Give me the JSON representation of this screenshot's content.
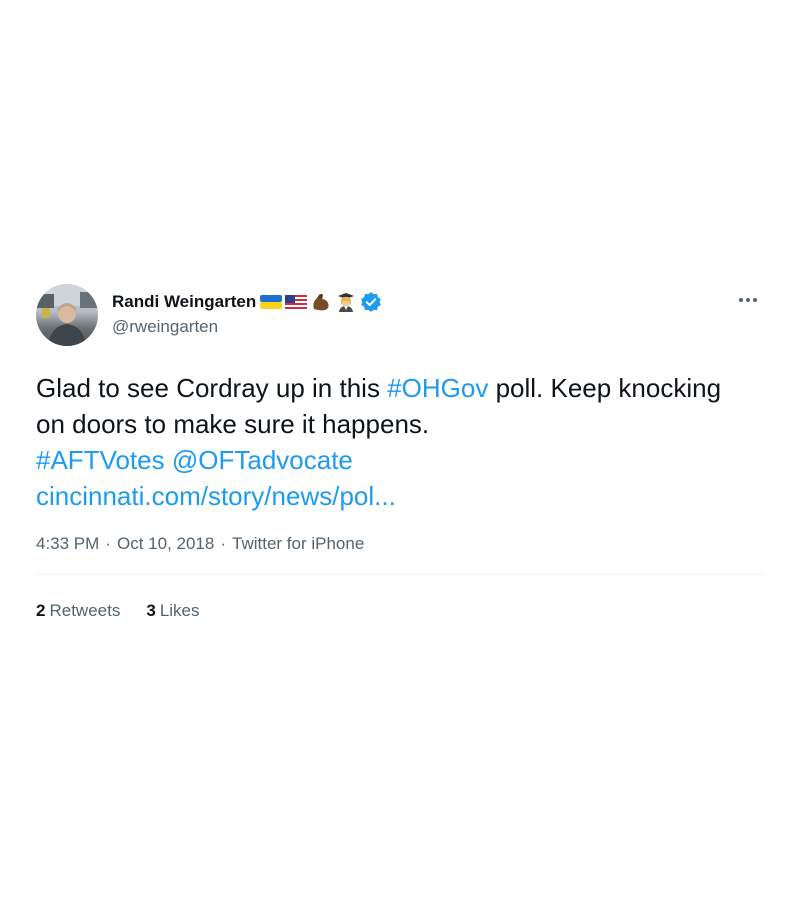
{
  "user": {
    "display_name": "Randi Weingarten",
    "handle": "@rweingarten",
    "verified": true,
    "badge_icons": [
      "ukraine-flag-icon",
      "us-flag-icon",
      "flexed-biceps-icon",
      "teacher-icon"
    ]
  },
  "tweet": {
    "line1_text": "Glad to see Cordray up in this ",
    "hashtag1": "#OHGov",
    "line1_rest": " poll. Keep knocking on doors to make sure it happens.",
    "hashtag2": "#AFTVotes",
    "mention": "@OFTadvocate",
    "link": "cincinnati.com/story/news/pol..."
  },
  "meta": {
    "time": "4:33 PM",
    "sep1": "·",
    "date": "Oct 10, 2018",
    "sep2": "·",
    "source": "Twitter for iPhone"
  },
  "stats": {
    "retweets_count": "2",
    "retweets_label": "Retweets",
    "likes_count": "3",
    "likes_label": "Likes"
  },
  "colors": {
    "link": "#1d9bf0",
    "secondary_text": "#536471",
    "verified": "#1d9bf0"
  }
}
